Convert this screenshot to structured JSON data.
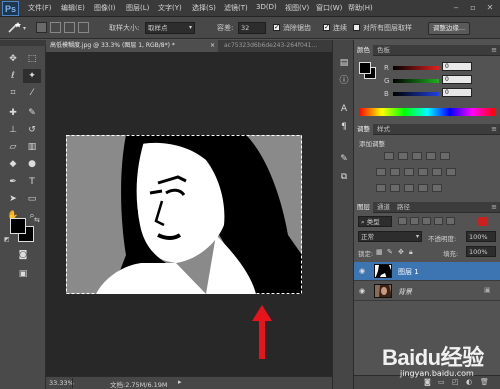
{
  "app": {
    "logo": "Ps"
  },
  "menu": [
    "文件(F)",
    "编辑(E)",
    "图像(I)",
    "图层(L)",
    "文字(Y)",
    "选择(S)",
    "滤镜(T)",
    "3D(D)",
    "视图(V)",
    "窗口(W)",
    "帮助(H)"
  ],
  "window_controls": {
    "minimize": "‒",
    "restore": "▫",
    "close": "✕"
  },
  "options": {
    "sample_size_label": "取样大小:",
    "sample_size_value": "取样点",
    "tolerance_label": "容差:",
    "tolerance_value": "32",
    "antialias_label": "消除锯齿",
    "contiguous_label": "连续",
    "sample_all_label": "对所有图层取样",
    "refine_edge_label": "调整边缘..."
  },
  "document": {
    "tab_active": "高低模糊度.jpg @ 33.3% (图层 1, RGB/8*) *",
    "tab_inactive": "ac75323d6b6de243-264f041..."
  },
  "status": {
    "zoom": "33.33%",
    "doc_info": "文档:2.75M/6.19M"
  },
  "color_panel": {
    "tabs": [
      "颜色",
      "色板"
    ],
    "channels": [
      {
        "label": "R",
        "value": "0",
        "color": "#e02020"
      },
      {
        "label": "G",
        "value": "0",
        "color": "#20b020"
      },
      {
        "label": "B",
        "value": "0",
        "color": "#2040e0"
      }
    ]
  },
  "adjust_panel": {
    "tabs": [
      "调整",
      "样式"
    ],
    "subtitle": "添加调整"
  },
  "layers_panel": {
    "tabs": [
      "图层",
      "通道",
      "路径"
    ],
    "kind_label": "类型",
    "blend_mode": "正常",
    "opacity_label": "不透明度:",
    "opacity_value": "100%",
    "lock_label": "锁定:",
    "fill_label": "填充:",
    "fill_value": "100%",
    "layers": [
      {
        "name": "图层 1",
        "selected": true
      },
      {
        "name": "背景",
        "selected": false
      }
    ]
  },
  "watermark": {
    "brand": "Baidu经验",
    "url": "jingyan.baidu.com"
  },
  "colors": {
    "accent_red": "#e8141b",
    "ps_blue": "#4d86c4"
  }
}
